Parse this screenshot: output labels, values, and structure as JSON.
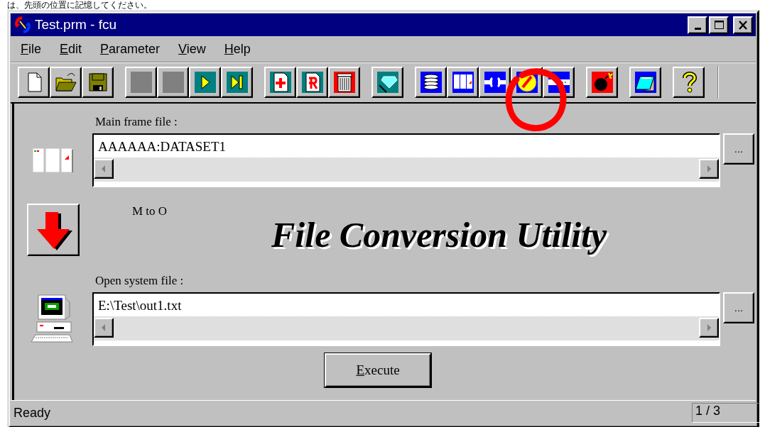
{
  "note_above": "は、先頭の位置に記憶してください。",
  "window": {
    "title": "Test.prm - fcu"
  },
  "menu": [
    "File",
    "Edit",
    "Parameter",
    "View",
    "Help"
  ],
  "main_frame": {
    "label": "Main frame file :",
    "value": "AAAAAA:DATASET1",
    "browse": "..."
  },
  "direction": "M to O",
  "banner": "File Conversion Utility",
  "open_system": {
    "label": "Open system file :",
    "value": "E:\\Test\\out1.txt",
    "browse": "..."
  },
  "execute_button": "Execute",
  "status_bar": {
    "message": "Ready",
    "page": "1 / 3"
  }
}
